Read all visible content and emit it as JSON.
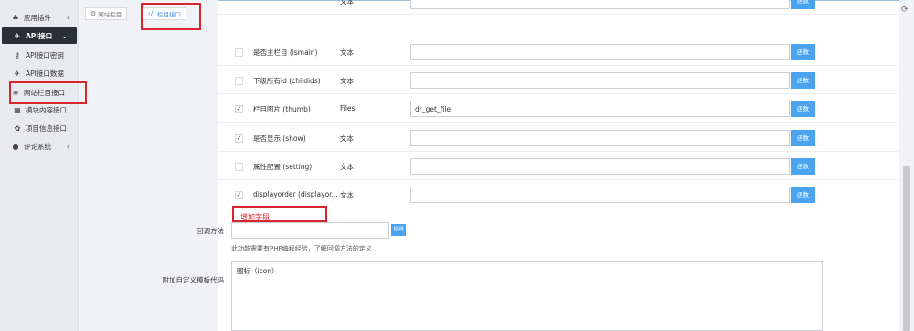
{
  "sidebar": {
    "items": [
      {
        "icon": "plugin-icon",
        "glyph": "♣",
        "label": "应用插件",
        "arrow": "‹"
      },
      {
        "icon": "rocket-icon",
        "glyph": "✈",
        "label": "API接口",
        "arrow": "⌄"
      },
      {
        "icon": "key-icon",
        "glyph": "⚷",
        "label": "API接口密钥"
      },
      {
        "icon": "rocket-icon",
        "glyph": "✈",
        "label": "API接口数据"
      },
      {
        "icon": "list-icon",
        "glyph": "≡",
        "label": "网站栏目接口"
      },
      {
        "icon": "grid-icon",
        "glyph": "▦",
        "label": "模块内容接口"
      },
      {
        "icon": "gear-icon",
        "glyph": "✿",
        "label": "项目信息接口"
      },
      {
        "icon": "comments-icon",
        "glyph": "●",
        "label": "评论系统",
        "arrow": "‹"
      }
    ]
  },
  "tabs": [
    {
      "icon": "gears-icon",
      "glyph": "⚙",
      "label": "网站栏目"
    },
    {
      "icon": "code-icon",
      "glyph": "‹/›",
      "label": "栏目接口"
    }
  ],
  "fields": [
    {
      "name": "是否主栏目 (ismain)",
      "type": "文本",
      "value": "",
      "checked": false,
      "btn": "函数"
    },
    {
      "name": "下级所有id (childids)",
      "type": "文本",
      "value": "",
      "checked": false,
      "btn": "函数"
    },
    {
      "name": "栏目图片 (thumb)",
      "type": "Files",
      "value": "dr_get_file",
      "checked": true,
      "btn": "函数"
    },
    {
      "name": "是否显示 (show)",
      "type": "文本",
      "value": "",
      "checked": true,
      "btn": "函数"
    },
    {
      "name": "属性配置 (setting)",
      "type": "文本",
      "value": "",
      "checked": false,
      "btn": "函数"
    },
    {
      "name": "displayorder (displayor...",
      "type": "文本",
      "value": "",
      "checked": true,
      "btn": "函数"
    }
  ],
  "top_row": {
    "type": "文本",
    "btn": "函数"
  },
  "add_field": "增加字段",
  "callback": {
    "label": "回调方法",
    "value": "",
    "btn": "检测",
    "help": "此功能需要有PHP编程经验，了解回调方法的定义"
  },
  "template": {
    "label": "附加自定义模板代码",
    "value": "图标（icon）"
  },
  "check_mark": "✓",
  "refresh_icon": "⟳"
}
